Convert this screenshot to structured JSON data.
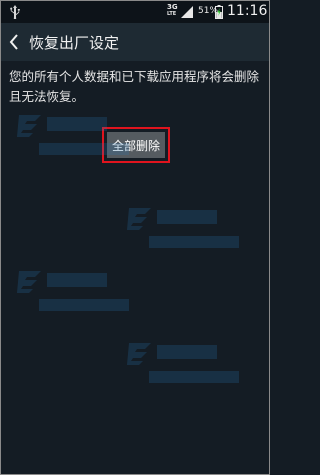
{
  "status_bar": {
    "network": "3G",
    "network_sub": "LTE",
    "battery_percent": "51%",
    "time": "11:16",
    "icons": [
      "usb-icon",
      "signal-icon",
      "battery-charging-icon"
    ]
  },
  "action_bar": {
    "title": "恢复出厂设定",
    "back_icon": "chevron-left-icon"
  },
  "content": {
    "description": "您的所有个人数据和已下载应用程序将会删除且无法恢复。",
    "delete_all_label": "全部删除"
  },
  "colors": {
    "background": "#141c24",
    "highlight": "#e0141e"
  }
}
